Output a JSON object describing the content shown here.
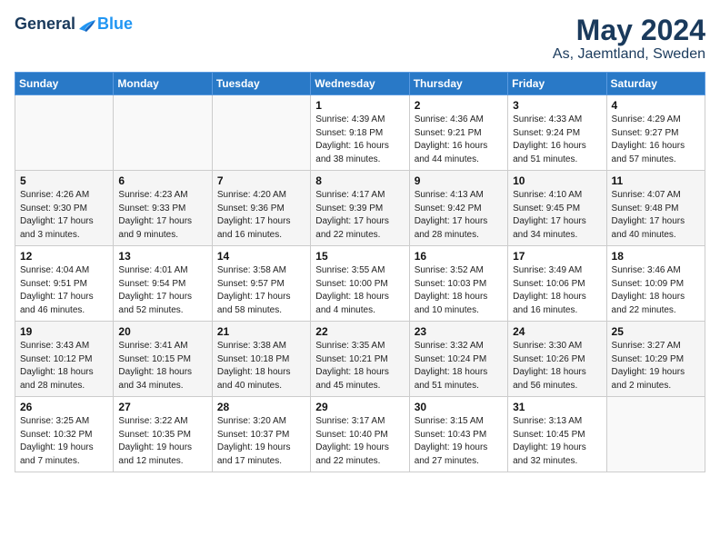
{
  "header": {
    "logo_general": "General",
    "logo_blue": "Blue",
    "title": "May 2024",
    "subtitle": "As, Jaemtland, Sweden"
  },
  "days_of_week": [
    "Sunday",
    "Monday",
    "Tuesday",
    "Wednesday",
    "Thursday",
    "Friday",
    "Saturday"
  ],
  "weeks": [
    [
      {
        "day": "",
        "info": ""
      },
      {
        "day": "",
        "info": ""
      },
      {
        "day": "",
        "info": ""
      },
      {
        "day": "1",
        "info": "Sunrise: 4:39 AM\nSunset: 9:18 PM\nDaylight: 16 hours\nand 38 minutes."
      },
      {
        "day": "2",
        "info": "Sunrise: 4:36 AM\nSunset: 9:21 PM\nDaylight: 16 hours\nand 44 minutes."
      },
      {
        "day": "3",
        "info": "Sunrise: 4:33 AM\nSunset: 9:24 PM\nDaylight: 16 hours\nand 51 minutes."
      },
      {
        "day": "4",
        "info": "Sunrise: 4:29 AM\nSunset: 9:27 PM\nDaylight: 16 hours\nand 57 minutes."
      }
    ],
    [
      {
        "day": "5",
        "info": "Sunrise: 4:26 AM\nSunset: 9:30 PM\nDaylight: 17 hours\nand 3 minutes."
      },
      {
        "day": "6",
        "info": "Sunrise: 4:23 AM\nSunset: 9:33 PM\nDaylight: 17 hours\nand 9 minutes."
      },
      {
        "day": "7",
        "info": "Sunrise: 4:20 AM\nSunset: 9:36 PM\nDaylight: 17 hours\nand 16 minutes."
      },
      {
        "day": "8",
        "info": "Sunrise: 4:17 AM\nSunset: 9:39 PM\nDaylight: 17 hours\nand 22 minutes."
      },
      {
        "day": "9",
        "info": "Sunrise: 4:13 AM\nSunset: 9:42 PM\nDaylight: 17 hours\nand 28 minutes."
      },
      {
        "day": "10",
        "info": "Sunrise: 4:10 AM\nSunset: 9:45 PM\nDaylight: 17 hours\nand 34 minutes."
      },
      {
        "day": "11",
        "info": "Sunrise: 4:07 AM\nSunset: 9:48 PM\nDaylight: 17 hours\nand 40 minutes."
      }
    ],
    [
      {
        "day": "12",
        "info": "Sunrise: 4:04 AM\nSunset: 9:51 PM\nDaylight: 17 hours\nand 46 minutes."
      },
      {
        "day": "13",
        "info": "Sunrise: 4:01 AM\nSunset: 9:54 PM\nDaylight: 17 hours\nand 52 minutes."
      },
      {
        "day": "14",
        "info": "Sunrise: 3:58 AM\nSunset: 9:57 PM\nDaylight: 17 hours\nand 58 minutes."
      },
      {
        "day": "15",
        "info": "Sunrise: 3:55 AM\nSunset: 10:00 PM\nDaylight: 18 hours\nand 4 minutes."
      },
      {
        "day": "16",
        "info": "Sunrise: 3:52 AM\nSunset: 10:03 PM\nDaylight: 18 hours\nand 10 minutes."
      },
      {
        "day": "17",
        "info": "Sunrise: 3:49 AM\nSunset: 10:06 PM\nDaylight: 18 hours\nand 16 minutes."
      },
      {
        "day": "18",
        "info": "Sunrise: 3:46 AM\nSunset: 10:09 PM\nDaylight: 18 hours\nand 22 minutes."
      }
    ],
    [
      {
        "day": "19",
        "info": "Sunrise: 3:43 AM\nSunset: 10:12 PM\nDaylight: 18 hours\nand 28 minutes."
      },
      {
        "day": "20",
        "info": "Sunrise: 3:41 AM\nSunset: 10:15 PM\nDaylight: 18 hours\nand 34 minutes."
      },
      {
        "day": "21",
        "info": "Sunrise: 3:38 AM\nSunset: 10:18 PM\nDaylight: 18 hours\nand 40 minutes."
      },
      {
        "day": "22",
        "info": "Sunrise: 3:35 AM\nSunset: 10:21 PM\nDaylight: 18 hours\nand 45 minutes."
      },
      {
        "day": "23",
        "info": "Sunrise: 3:32 AM\nSunset: 10:24 PM\nDaylight: 18 hours\nand 51 minutes."
      },
      {
        "day": "24",
        "info": "Sunrise: 3:30 AM\nSunset: 10:26 PM\nDaylight: 18 hours\nand 56 minutes."
      },
      {
        "day": "25",
        "info": "Sunrise: 3:27 AM\nSunset: 10:29 PM\nDaylight: 19 hours\nand 2 minutes."
      }
    ],
    [
      {
        "day": "26",
        "info": "Sunrise: 3:25 AM\nSunset: 10:32 PM\nDaylight: 19 hours\nand 7 minutes."
      },
      {
        "day": "27",
        "info": "Sunrise: 3:22 AM\nSunset: 10:35 PM\nDaylight: 19 hours\nand 12 minutes."
      },
      {
        "day": "28",
        "info": "Sunrise: 3:20 AM\nSunset: 10:37 PM\nDaylight: 19 hours\nand 17 minutes."
      },
      {
        "day": "29",
        "info": "Sunrise: 3:17 AM\nSunset: 10:40 PM\nDaylight: 19 hours\nand 22 minutes."
      },
      {
        "day": "30",
        "info": "Sunrise: 3:15 AM\nSunset: 10:43 PM\nDaylight: 19 hours\nand 27 minutes."
      },
      {
        "day": "31",
        "info": "Sunrise: 3:13 AM\nSunset: 10:45 PM\nDaylight: 19 hours\nand 32 minutes."
      },
      {
        "day": "",
        "info": ""
      }
    ]
  ]
}
